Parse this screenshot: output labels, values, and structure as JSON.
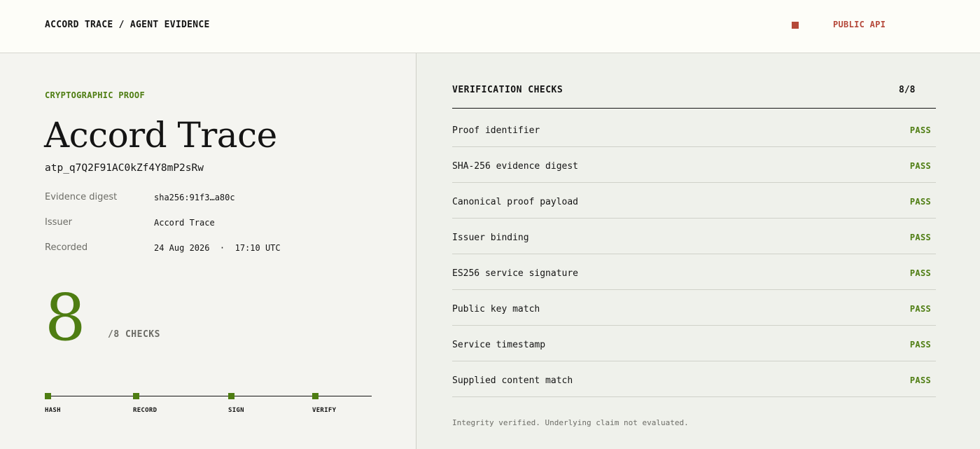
{
  "header": {
    "breadcrumb": "ACCORD TRACE / AGENT EVIDENCE",
    "api_link": "PUBLIC API"
  },
  "proof": {
    "eyebrow": "CRYPTOGRAPHIC PROOF",
    "title": "Accord Trace",
    "id": "atp_q7Q2F91AC0kZf4Y8mP2sRw",
    "meta": [
      {
        "label": "Evidence digest",
        "value": "sha256:91f3…a80c"
      },
      {
        "label": "Issuer",
        "value": "Accord Trace"
      },
      {
        "label": "Recorded",
        "value": "24 Aug 2026  ·  17:10 UTC"
      }
    ],
    "passed_count": "8",
    "count_suffix": "/8 CHECKS",
    "steps": [
      "HASH",
      "RECORD",
      "SIGN",
      "VERIFY"
    ]
  },
  "checks": {
    "heading": "VERIFICATION CHECKS",
    "count": "8/8",
    "items": [
      {
        "name": "Proof identifier",
        "status": "PASS"
      },
      {
        "name": "SHA-256 evidence digest",
        "status": "PASS"
      },
      {
        "name": "Canonical proof payload",
        "status": "PASS"
      },
      {
        "name": "Issuer binding",
        "status": "PASS"
      },
      {
        "name": "ES256 service signature",
        "status": "PASS"
      },
      {
        "name": "Public key match",
        "status": "PASS"
      },
      {
        "name": "Service timestamp",
        "status": "PASS"
      },
      {
        "name": "Supplied content match",
        "status": "PASS"
      }
    ],
    "footnote": "Integrity verified. Underlying claim not evaluated."
  },
  "colors": {
    "accent_green": "#4e7d12",
    "accent_red": "#b5483a",
    "ink": "#141414",
    "muted": "#6c6c66"
  }
}
